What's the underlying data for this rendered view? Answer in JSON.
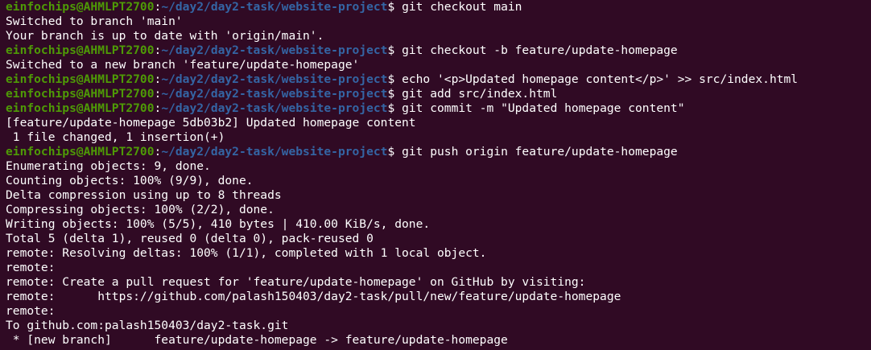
{
  "colors": {
    "background": "#300a24",
    "prompt_user": "#4e9a06",
    "prompt_path": "#3465a4",
    "text": "#ffffff"
  },
  "prompt": {
    "user": "einfochips@AHMLPT2700",
    "path": "~/day2/day2-task/website-project"
  },
  "lines": [
    {
      "kind": "cmd",
      "text": "git checkout main"
    },
    {
      "kind": "out",
      "text": "Switched to branch 'main'"
    },
    {
      "kind": "out",
      "text": "Your branch is up to date with 'origin/main'."
    },
    {
      "kind": "cmd",
      "text": "git checkout -b feature/update-homepage"
    },
    {
      "kind": "out",
      "text": "Switched to a new branch 'feature/update-homepage'"
    },
    {
      "kind": "cmd",
      "text": "echo '<p>Updated homepage content</p>' >> src/index.html"
    },
    {
      "kind": "cmd",
      "text": "git add src/index.html"
    },
    {
      "kind": "cmd",
      "text": "git commit -m \"Updated homepage content\""
    },
    {
      "kind": "out",
      "text": "[feature/update-homepage 5db03b2] Updated homepage content"
    },
    {
      "kind": "out",
      "text": " 1 file changed, 1 insertion(+)"
    },
    {
      "kind": "cmd",
      "text": "git push origin feature/update-homepage"
    },
    {
      "kind": "out",
      "text": "Enumerating objects: 9, done."
    },
    {
      "kind": "out",
      "text": "Counting objects: 100% (9/9), done."
    },
    {
      "kind": "out",
      "text": "Delta compression using up to 8 threads"
    },
    {
      "kind": "out",
      "text": "Compressing objects: 100% (2/2), done."
    },
    {
      "kind": "out",
      "text": "Writing objects: 100% (5/5), 410 bytes | 410.00 KiB/s, done."
    },
    {
      "kind": "out",
      "text": "Total 5 (delta 1), reused 0 (delta 0), pack-reused 0"
    },
    {
      "kind": "out",
      "text": "remote: Resolving deltas: 100% (1/1), completed with 1 local object."
    },
    {
      "kind": "out",
      "text": "remote:"
    },
    {
      "kind": "out",
      "text": "remote: Create a pull request for 'feature/update-homepage' on GitHub by visiting:"
    },
    {
      "kind": "out",
      "text": "remote:      https://github.com/palash150403/day2-task/pull/new/feature/update-homepage"
    },
    {
      "kind": "out",
      "text": "remote:"
    },
    {
      "kind": "out",
      "text": "To github.com:palash150403/day2-task.git"
    },
    {
      "kind": "out",
      "text": " * [new branch]      feature/update-homepage -> feature/update-homepage"
    }
  ]
}
